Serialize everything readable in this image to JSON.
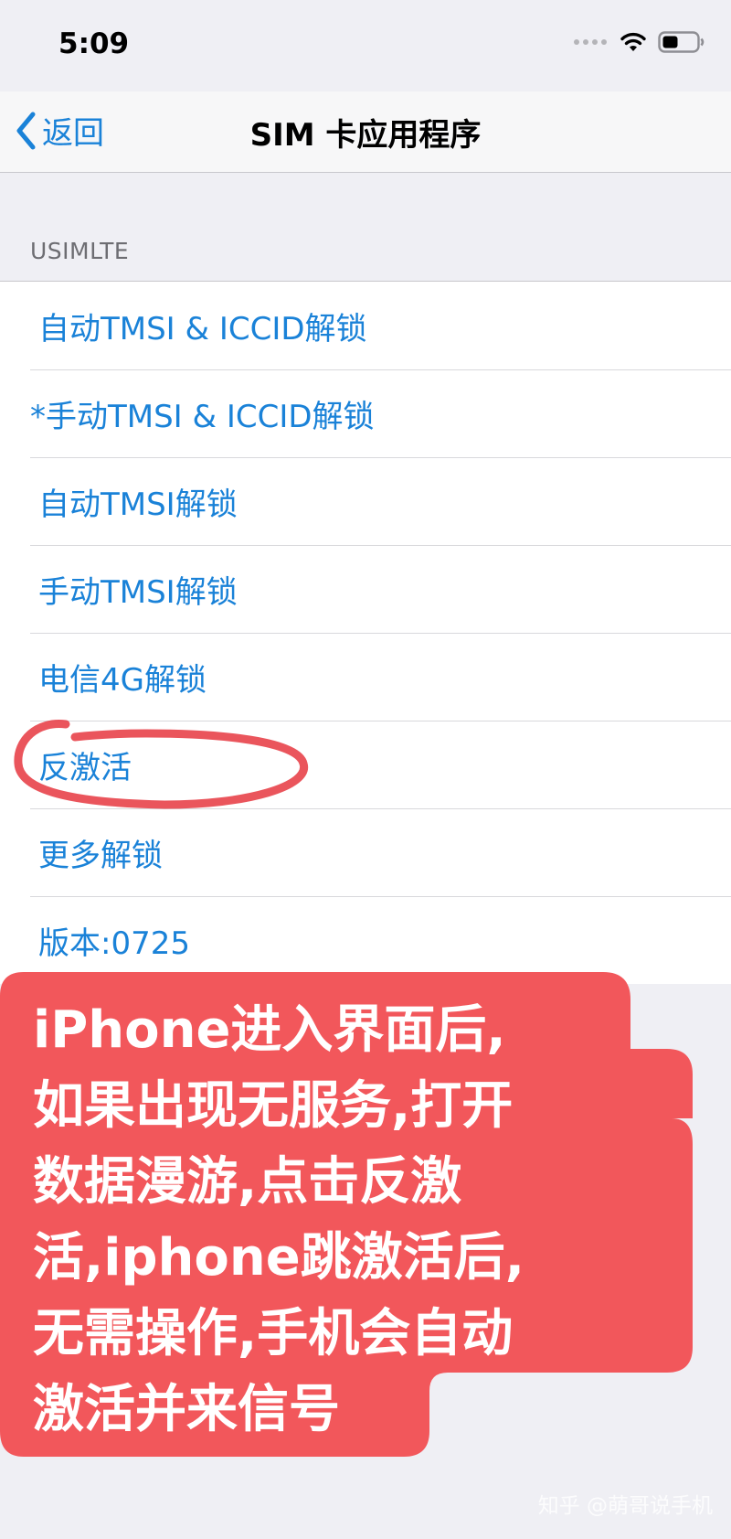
{
  "status_bar": {
    "time": "5:09",
    "signal_icon": "signal-dots-icon",
    "wifi_icon": "wifi-icon",
    "battery_icon": "battery-icon"
  },
  "nav": {
    "back_label": "返回",
    "back_icon": "chevron-left-icon",
    "title": "SIM 卡应用程序"
  },
  "section": {
    "header": "USIMLTE"
  },
  "items": [
    {
      "label": "自动TMSI & ICCID解锁"
    },
    {
      "label": "*手动TMSI & ICCID解锁"
    },
    {
      "label": "自动TMSI解锁"
    },
    {
      "label": "手动TMSI解锁"
    },
    {
      "label": "电信4G解锁"
    },
    {
      "label": "反激活"
    },
    {
      "label": "更多解锁"
    },
    {
      "label": "版本:0725"
    }
  ],
  "annotation": {
    "lines": [
      "iPhone进入界面后,",
      "如果出现无服务,打开",
      "数据漫游,点击反激",
      "活,iphone跳激活后,",
      "无需操作,手机会自动",
      "激活并来信号"
    ],
    "bubble_color": "#f2575b",
    "circle_color": "#e8424a"
  },
  "watermark": "知乎 @萌哥说手机",
  "colors": {
    "accent": "#1a82d8",
    "background": "#efeff4"
  }
}
